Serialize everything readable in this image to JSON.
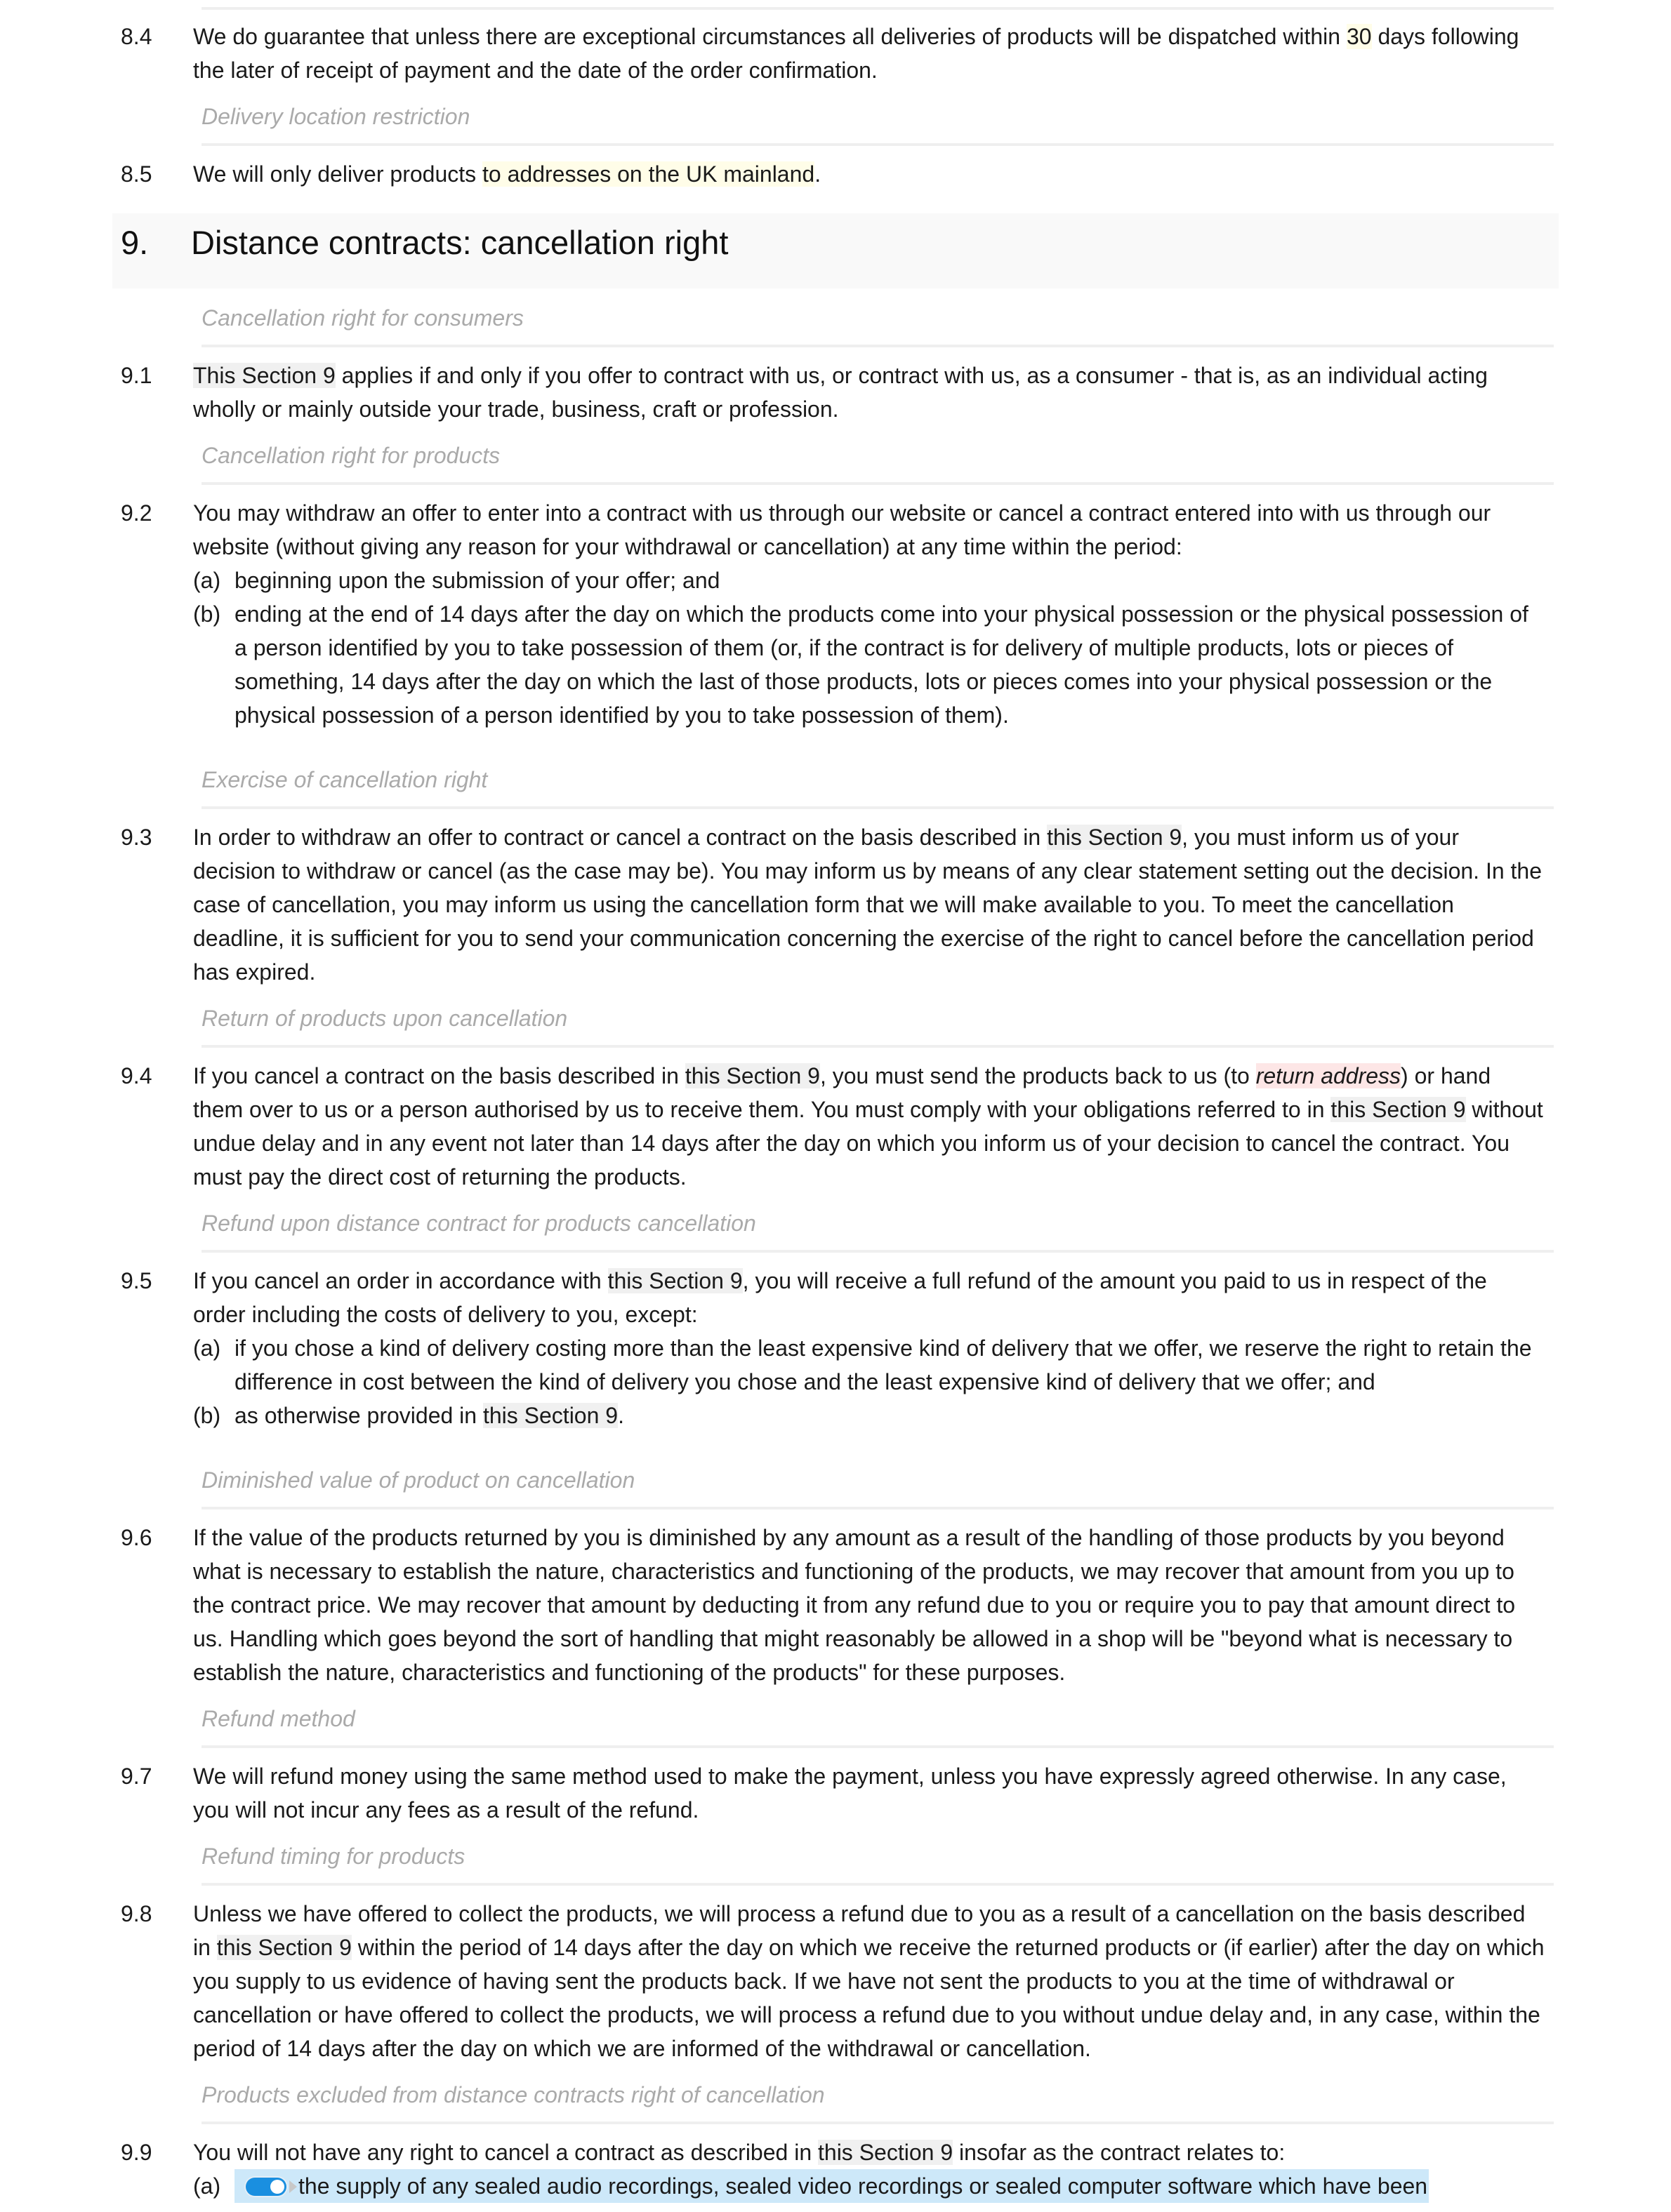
{
  "document": {
    "clauses_8": [
      {
        "number": "8.4",
        "text_before": "We do guarantee that unless there are exceptional circumstances all deliveries of products will be dispatched within ",
        "variable": "30",
        "text_after": " days following the later of receipt of payment and the date of the order confirmation."
      }
    ],
    "sub_8_5": "Delivery location restriction",
    "clause_8_5": {
      "number": "8.5",
      "text_before": "We will only deliver products ",
      "variable": "to addresses on the UK mainland",
      "text_after": "."
    },
    "section_9": {
      "number": "9.",
      "title": "Distance contracts: cancellation right"
    },
    "c9_1": {
      "subheading": "Cancellation right for consumers",
      "number": "9.1",
      "xref": "This Section 9",
      "text": " applies if and only if you offer to contract with us, or contract with us, as a consumer - that is, as an individual acting wholly or mainly outside your trade, business, craft or profession."
    },
    "c9_2": {
      "subheading": "Cancellation right for products",
      "number": "9.2",
      "text": "You may withdraw an offer to enter into a contract with us through our website or cancel a contract entered into with us through our website (without giving any reason for your withdrawal or cancellation) at any time within the period:",
      "items": [
        {
          "marker": "(a)",
          "text": "beginning upon the submission of your offer; and"
        },
        {
          "marker": "(b)",
          "text": "ending at the end of 14 days after the day on which the products come into your physical possession or the physical possession of a person identified by you to take possession of them (or, if the contract is for delivery of multiple products, lots or pieces of something, 14 days after the day on which the last of those products, lots or pieces comes into your physical possession or the physical possession of a person identified by you to take possession of them)."
        }
      ]
    },
    "c9_3": {
      "subheading": "Exercise of cancellation right",
      "number": "9.3",
      "text_before": "In order to withdraw an offer to contract or cancel a contract on the basis described in ",
      "xref": "this Section 9",
      "text_after": ", you must inform us of your decision to withdraw or cancel (as the case may be). You may inform us by means of any clear statement setting out the decision. In the case of cancellation, you may inform us using the cancellation form that we will make available to you. To meet the cancellation deadline, it is sufficient for you to send your communication concerning the exercise of the right to cancel before the cancellation period has expired."
    },
    "c9_4": {
      "subheading": "Return of products upon cancellation",
      "number": "9.4",
      "text_1": "If you cancel a contract on the basis described in ",
      "xref_1": "this Section 9",
      "text_2": ", you must send the products back to us (to ",
      "variable": "return address",
      "text_3": ") or hand them over to us or a person authorised by us to receive them. You must comply with your obligations referred to in ",
      "xref_2": "this Section 9",
      "text_4": " without undue delay and in any event not later than 14 days after the day on which you inform us of your decision to cancel the contract. You must pay the direct cost of returning the products."
    },
    "c9_5": {
      "subheading": "Refund upon distance contract for products cancellation",
      "number": "9.5",
      "text_before": "If you cancel an order in accordance with ",
      "xref": "this Section 9",
      "text_after": ", you will receive a full refund of the amount you paid to us in respect of the order including the costs of delivery to you, except:",
      "item_a_marker": "(a)",
      "item_a_text": "if you chose a kind of delivery costing more than the least expensive kind of delivery that we offer, we reserve the right to retain the difference in cost between the kind of delivery you chose and the least expensive kind of delivery that we offer; and",
      "item_b_marker": "(b)",
      "item_b_text": "as otherwise provided in ",
      "item_b_xref": "this Section 9",
      "item_b_end": "."
    },
    "c9_6": {
      "subheading": "Diminished value of product on cancellation",
      "number": "9.6",
      "text": "If the value of the products returned by you is diminished by any amount as a result of the handling of those products by you beyond what is necessary to establish the nature, characteristics and functioning of the products, we may recover that amount from you up to the contract price. We may recover that amount by deducting it from any refund due to you or require you to pay that amount direct to us. Handling which goes beyond the sort of handling that might reasonably be allowed in a shop will be \"beyond what is necessary to establish the nature, characteristics and functioning of the products\" for these purposes."
    },
    "c9_7": {
      "subheading": "Refund method",
      "number": "9.7",
      "text": "We will refund money using the same method used to make the payment, unless you have expressly agreed otherwise. In any case, you will not incur any fees as a result of the refund."
    },
    "c9_8": {
      "subheading": "Refund timing for products",
      "number": "9.8",
      "text_before": "Unless we have offered to collect the products, we will process a refund due to you as a result of a cancellation on the basis described in ",
      "xref": "this Section 9",
      "text_after": " within the period of 14 days after the day on which we receive the returned products or (if earlier) after the day on which you supply to us evidence of having sent the products back. If we have not sent the products to you at the time of withdrawal or cancellation or have offered to collect the products, we will process a refund due to you without undue delay and, in any case, within the period of 14 days after the day on which we are informed of the withdrawal or cancellation."
    },
    "c9_9": {
      "subheading": "Products excluded from distance contracts right of cancellation",
      "number": "9.9",
      "text_before": "You will not have any right to cancel a contract as described in ",
      "xref": "this Section 9",
      "text_after": " insofar as the contract relates to:",
      "item_a_marker": "(a)",
      "item_a_toggle_on": true,
      "item_a_text": "the supply of any sealed audio recordings, sealed video recordings or sealed computer software which have been"
    }
  },
  "colors": {
    "variable_highlight": "#fffde8",
    "missing_variable_highlight": "#fde6e6",
    "cross_reference_highlight": "#f0f0f0",
    "optional_clause_highlight": "#cde8f9",
    "toggle_on": "#1a8fe0",
    "subheading_text": "#aaaaaa",
    "heading_band": "#f9f9f9"
  }
}
